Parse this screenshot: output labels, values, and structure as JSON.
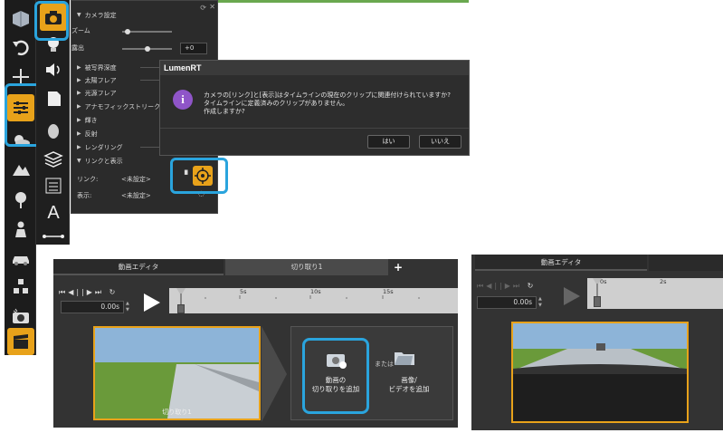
{
  "props": {
    "camera_settings": "カメラ設定",
    "zoom_label": "ズーム",
    "exposure_label": "露出",
    "exposure_value": "+0",
    "sections": [
      "被写界深度",
      "太陽フレア",
      "光源フレア",
      "アナモフィックストリーク",
      "輝き",
      "反射",
      "レンダリング"
    ],
    "link_display": "リンクと表示",
    "link_label": "リンク:",
    "display_label": "表示:",
    "unset": "<未設定>",
    "zoom_level": 0.1,
    "exposure_level": 0.5
  },
  "dialog": {
    "title": "LumenRT",
    "message": "カメラの[リンク]と[表示]はタイムラインの現在のクリップに関連付けられていますか?\nタイムラインに定義済みのクリップがありません。\n作成しますか?",
    "yes": "はい",
    "no": "いいえ"
  },
  "timeline": {
    "tab_editor": "動画エディタ",
    "tab_clip": "切り取り1",
    "add_tab": "+",
    "time": "0.00s",
    "ticks": [
      "5s",
      "10s",
      "15s"
    ],
    "clip_name": "切り取り1",
    "add_clip_label": "動画の\n切り取りを追加",
    "or": "または",
    "add_media_label": "画像/\nビデオを追加"
  },
  "right_timeline": {
    "tab_editor": "動画エディタ",
    "time": "0.00s",
    "ticks": [
      "0s",
      "2s"
    ]
  },
  "colors": {
    "accent_orange": "#e8a21a",
    "highlight_blue": "#2aa4dd",
    "clip_border": "#e8a21a"
  }
}
